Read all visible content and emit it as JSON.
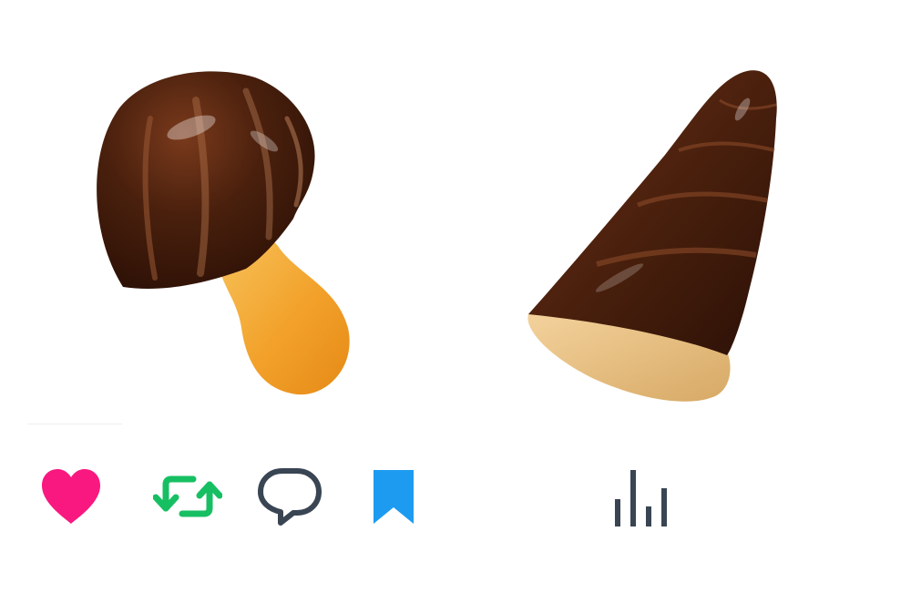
{
  "colors": {
    "like": "#f91880",
    "retweet": "#17bf63",
    "reply": "#3a4553",
    "bookmark": "#1d9bf0",
    "analytics": "#3a4553",
    "chocolate": "#3b1a0c",
    "biscuit": "#f2a12a"
  },
  "images": [
    {
      "name": "mushroom-snack",
      "description_icon": "mushroom-chocolate-biscuit"
    },
    {
      "name": "bamboo-shoot-snack",
      "description_icon": "bamboo-shoot-chocolate-biscuit"
    }
  ],
  "actions": {
    "like_icon": "heart-icon",
    "retweet_icon": "retweet-icon",
    "reply_icon": "speech-bubble-icon",
    "bookmark_icon": "bookmark-icon",
    "analytics_icon": "bar-chart-icon"
  }
}
